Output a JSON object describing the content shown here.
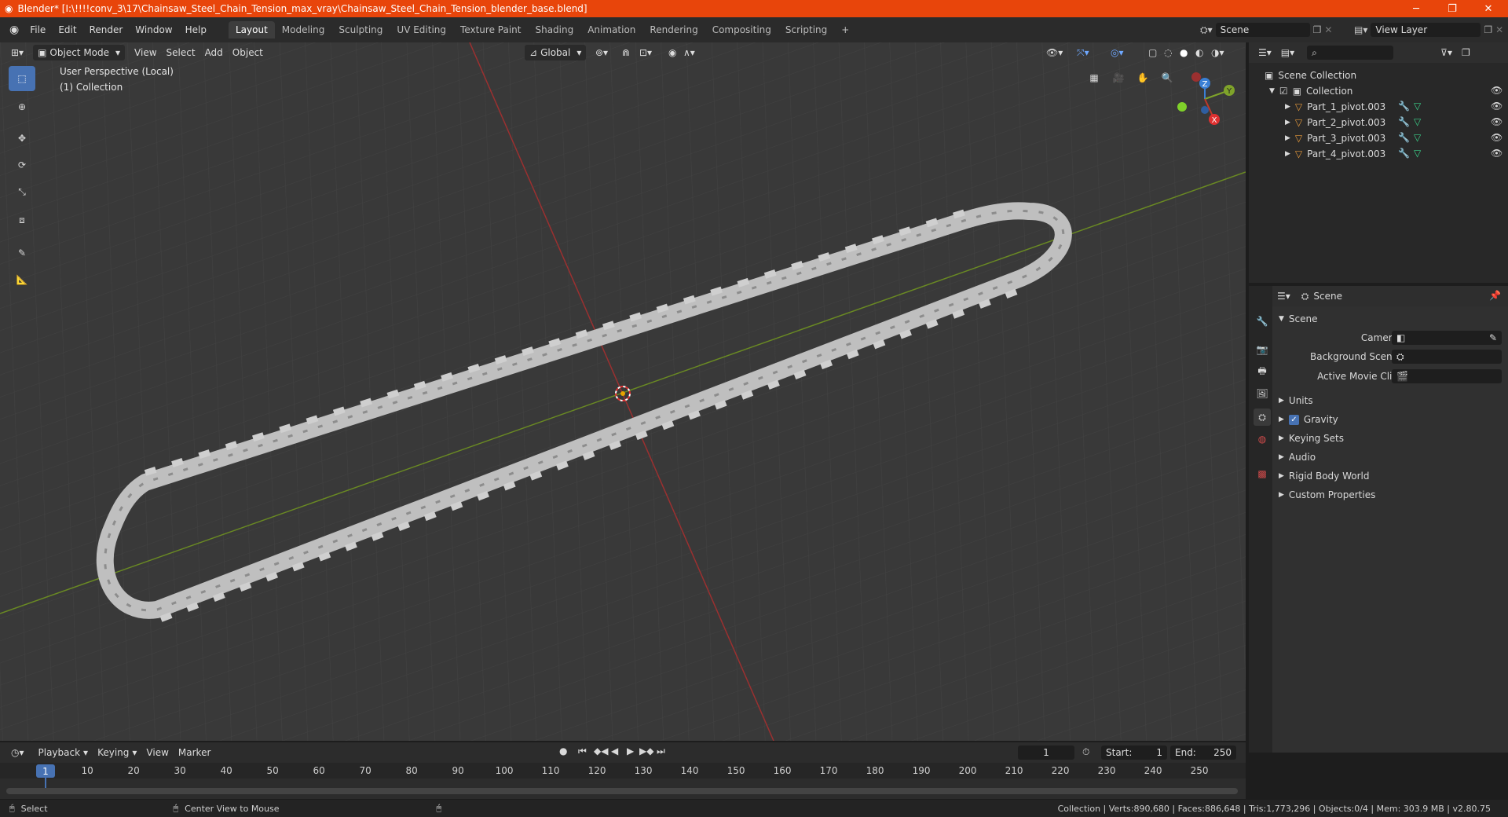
{
  "window": {
    "title": "Blender* [I:\\!!!!conv_3\\17\\Chainsaw_Steel_Chain_Tension_max_vray\\Chainsaw_Steel_Chain_Tension_blender_base.blend]",
    "minimize": "─",
    "restore": "❐",
    "close": "✕"
  },
  "menus": [
    "File",
    "Edit",
    "Render",
    "Window",
    "Help"
  ],
  "workspaces": [
    "Layout",
    "Modeling",
    "Sculpting",
    "UV Editing",
    "Texture Paint",
    "Shading",
    "Animation",
    "Rendering",
    "Compositing",
    "Scripting"
  ],
  "active_workspace": "Layout",
  "add_workspace": "+",
  "scene_field": "Scene",
  "view_layer_field": "View Layer",
  "viewport": {
    "mode": "Object Mode",
    "menus": [
      "View",
      "Select",
      "Add",
      "Object"
    ],
    "transform": "Global",
    "info_line1": "User Perspective (Local)",
    "info_line2": "(1) Collection",
    "gizmo": {
      "z": "Z",
      "y": "Y",
      "x": "X"
    }
  },
  "outliner": {
    "root": "Scene Collection",
    "collection": "Collection",
    "items": [
      "Part_1_pivot.003",
      "Part_2_pivot.003",
      "Part_3_pivot.003",
      "Part_4_pivot.003"
    ]
  },
  "properties": {
    "header": "Scene",
    "panel": "Scene",
    "fields": [
      {
        "label": "Camera"
      },
      {
        "label": "Background Scene"
      },
      {
        "label": "Active Movie Clip"
      }
    ],
    "sections": [
      "Units",
      "Gravity",
      "Keying Sets",
      "Audio",
      "Rigid Body World",
      "Custom Properties"
    ],
    "gravity_checked": true
  },
  "timeline": {
    "menus": [
      "Playback",
      "Keying",
      "View",
      "Marker"
    ],
    "current_frame": "1",
    "start_label": "Start:",
    "start": "1",
    "end_label": "End:",
    "end": "250",
    "ticks": [
      "1",
      "10",
      "20",
      "30",
      "40",
      "50",
      "60",
      "70",
      "80",
      "90",
      "100",
      "110",
      "120",
      "130",
      "140",
      "150",
      "160",
      "170",
      "180",
      "190",
      "200",
      "210",
      "220",
      "230",
      "240",
      "250"
    ]
  },
  "status": {
    "left": "Select",
    "middle": "Center View to Mouse",
    "right": "Collection | Verts:890,680 | Faces:886,648 | Tris:1,773,296 | Objects:0/4 | Mem: 303.9 MB | v2.80.75"
  },
  "colors": {
    "titlebar": "#e8450b",
    "accent": "#4772b3",
    "x_axis": "#c0392b",
    "y_axis": "#7fa32a",
    "z_axis": "#3a7fd5"
  }
}
